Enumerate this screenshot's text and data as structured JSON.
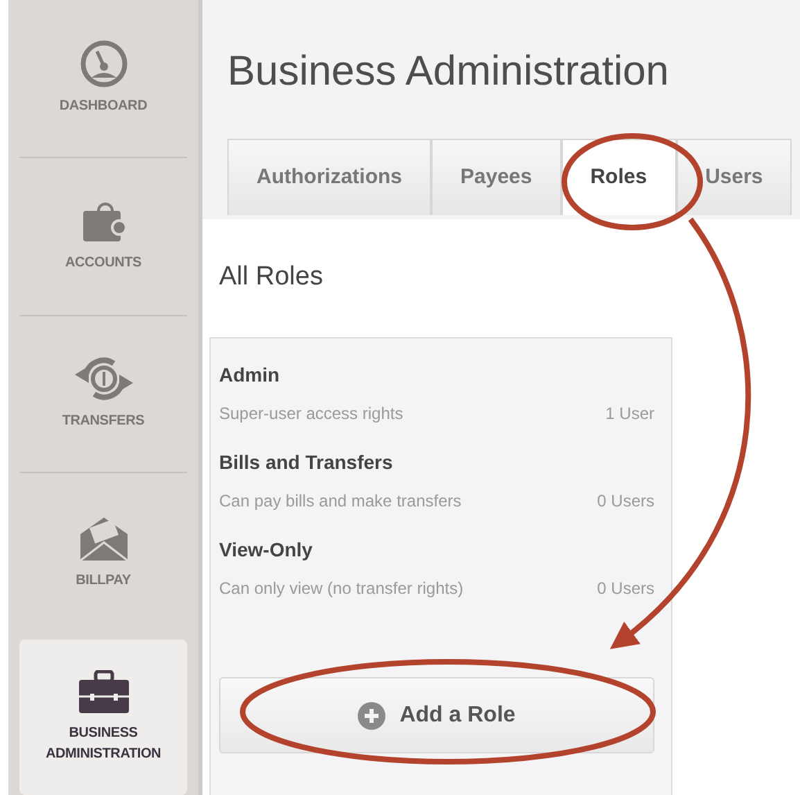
{
  "sidebar": {
    "items": [
      {
        "label": "DASHBOARD",
        "kind": "gauge",
        "selected": false
      },
      {
        "label": "ACCOUNTS",
        "kind": "wallet",
        "selected": false
      },
      {
        "label": "TRANSFERS",
        "kind": "exchange",
        "selected": false
      },
      {
        "label": "BILLPAY",
        "kind": "envelope",
        "selected": false
      },
      {
        "label": "BUSINESS ADMINISTRATION",
        "kind": "briefcase",
        "selected": true
      }
    ]
  },
  "page_title": "Business Administration",
  "tabs": [
    {
      "label": "Authorizations",
      "selected": false
    },
    {
      "label": "Payees",
      "selected": false
    },
    {
      "label": "Roles",
      "selected": true
    },
    {
      "label": "Users",
      "selected": false
    }
  ],
  "section_title": "All Roles",
  "roles": [
    {
      "name": "Admin",
      "description": "Super-user access rights",
      "count": "1 User"
    },
    {
      "name": "Bills and Transfers",
      "description": "Can pay bills and make transfers",
      "count": "0 Users"
    },
    {
      "name": "View-Only",
      "description": "Can only view (no transfer rights)",
      "count": "0 Users"
    }
  ],
  "add_button": {
    "label": "Add a Role"
  }
}
